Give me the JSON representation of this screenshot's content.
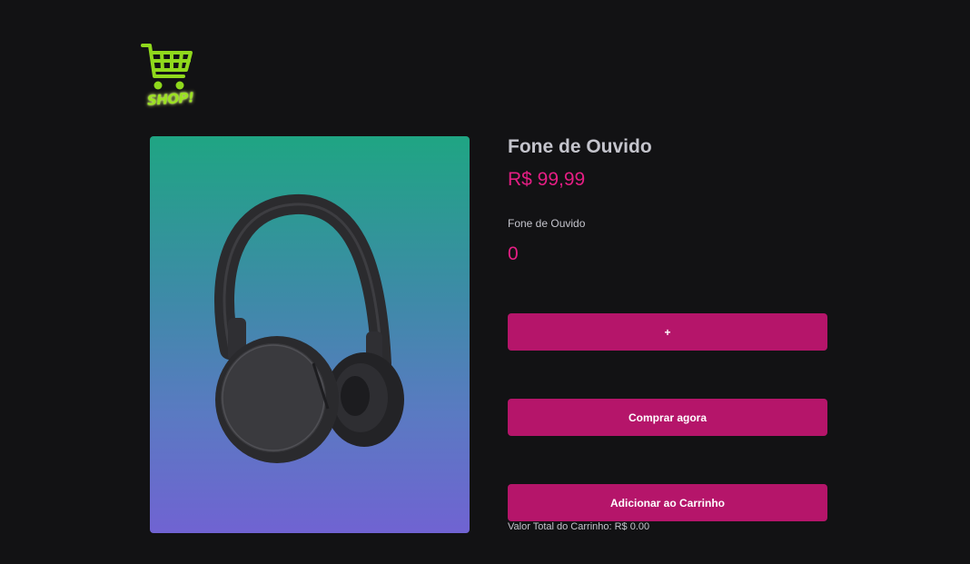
{
  "header": {
    "logo_text": "SHOP!",
    "logo_icon": "shopping-cart-icon"
  },
  "product": {
    "image": "headphones",
    "title": "Fone de Ouvido",
    "price": "R$ 99,99",
    "description": "Fone de Ouvido",
    "quantity": "0"
  },
  "actions": {
    "plus_label": "+",
    "buy_label": "Comprar agora",
    "add_to_cart_label": "Adicionar ao Carrinho"
  },
  "cart": {
    "total_text": "Valor Total do Carrinho: R$ 0.00"
  },
  "colors": {
    "background": "#121214",
    "accent": "#b5156a",
    "price": "#e51e84",
    "logo": "#9be320"
  }
}
